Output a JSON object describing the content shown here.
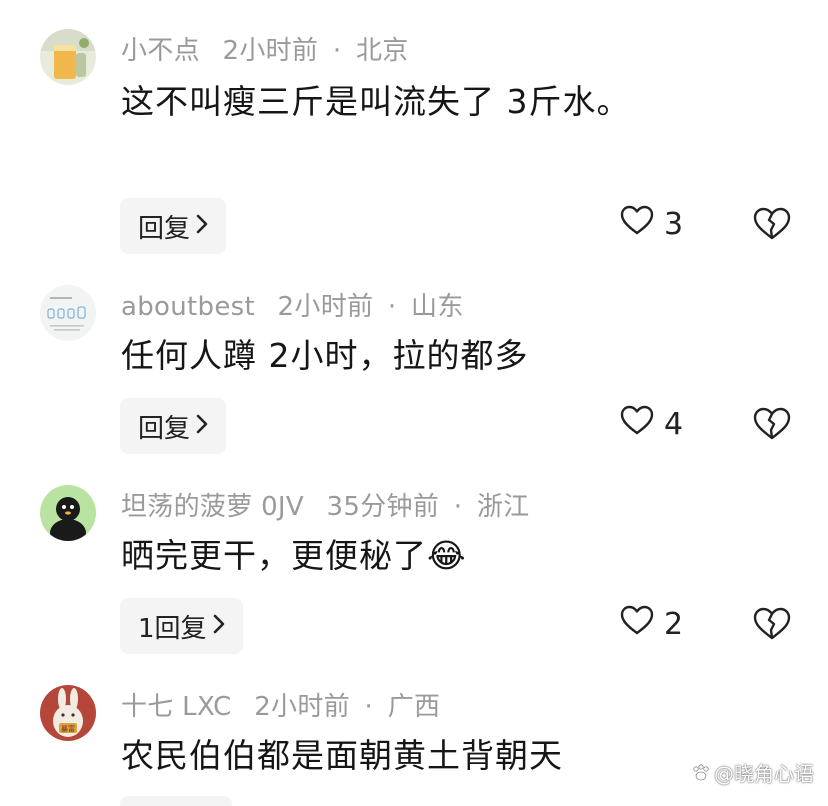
{
  "comments": [
    {
      "username": "小不点",
      "time": "2小时前",
      "location": "北京",
      "text": "这不叫瘦三斤是叫流失了 3斤水。",
      "reply_label": "回复",
      "likes": "3"
    },
    {
      "username": "aboutbest",
      "time": "2小时前",
      "location": "山东",
      "text": "任何人蹲 2小时，拉的都多",
      "reply_label": "回复",
      "likes": "4"
    },
    {
      "username": "坦荡的菠萝 0JV",
      "time": "35分钟前",
      "location": "浙江",
      "text": "晒完更干，更便秘了",
      "emoji": "😂",
      "reply_label": "1回复",
      "likes": "2"
    },
    {
      "username": "十七 LXC",
      "time": "2小时前",
      "location": "广西",
      "text": "农民伯伯都是面朝黄土背朝天"
    }
  ],
  "separator": "·",
  "avatar_badge": "暴富",
  "watermark": "@晓角心语"
}
